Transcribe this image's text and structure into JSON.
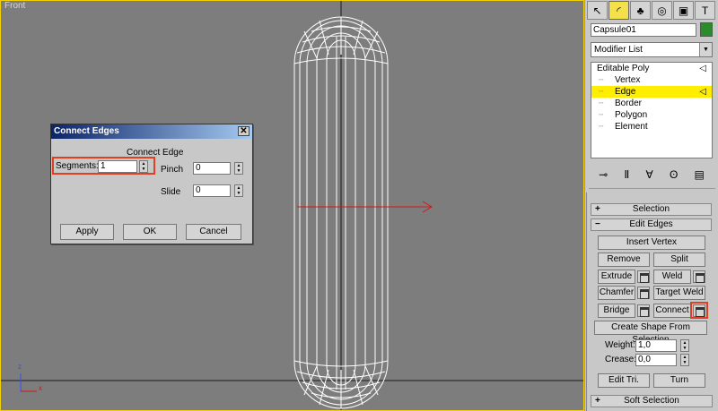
{
  "viewport": {
    "label": "Front",
    "axis_z": "z",
    "axis_x": "x"
  },
  "command_panel": {
    "object_name": "Capsule01",
    "modifier_list": "Modifier List",
    "stack": [
      {
        "label": "Editable Poly",
        "level": 0,
        "selected": false
      },
      {
        "label": "Vertex",
        "level": 1,
        "selected": false
      },
      {
        "label": "Edge",
        "level": 1,
        "selected": true
      },
      {
        "label": "Border",
        "level": 1,
        "selected": false
      },
      {
        "label": "Polygon",
        "level": 1,
        "selected": false
      },
      {
        "label": "Element",
        "level": 1,
        "selected": false
      }
    ],
    "rollouts": {
      "selection": "Selection",
      "edit_edges": "Edit Edges",
      "soft_selection": "Soft Selection",
      "insert_vertex": "Insert Vertex",
      "remove": "Remove",
      "split": "Split",
      "extrude": "Extrude",
      "weld": "Weld",
      "chamfer": "Chamfer",
      "target_weld": "Target Weld",
      "bridge": "Bridge",
      "connect": "Connect",
      "create_shape": "Create Shape From Selection",
      "weight_label": "Weight:",
      "weight_value": "1,0",
      "crease_label": "Crease:",
      "crease_value": "0,0",
      "edit_tri": "Edit Tri.",
      "turn": "Turn"
    }
  },
  "dialog": {
    "title": "Connect Edges",
    "subtitle": "Connect Edge",
    "segments_label": "Segments:",
    "segments_value": "1",
    "pinch_label": "Pinch",
    "pinch_value": "0",
    "slide_label": "Slide",
    "slide_value": "0",
    "apply": "Apply",
    "ok": "OK",
    "cancel": "Cancel"
  }
}
